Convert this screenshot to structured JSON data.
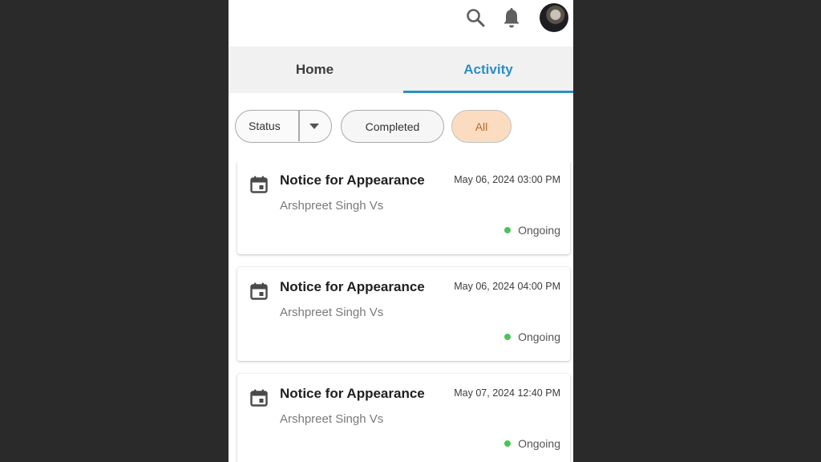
{
  "topbar": {
    "icons": [
      "search-icon",
      "bell-icon",
      "avatar"
    ]
  },
  "tabs": [
    {
      "label": "Home",
      "active": false
    },
    {
      "label": "Activity",
      "active": true
    }
  ],
  "colors": {
    "accent": "#2b8fc6",
    "chip_active_bg": "#fcdcc0",
    "chip_active_text": "#b8682a",
    "status_ongoing": "#4cc35a",
    "backdrop": "#2a2a2a"
  },
  "filters": {
    "status_label": "Status",
    "completed_label": "Completed",
    "all_label": "All",
    "selected": "All"
  },
  "activities": [
    {
      "title": "Notice for Appearance",
      "datetime": "May 06, 2024 03:00 PM",
      "subtitle": "Arshpreet Singh Vs",
      "status": "Ongoing",
      "icon": "calendar-icon"
    },
    {
      "title": "Notice for Appearance",
      "datetime": "May 06, 2024 04:00 PM",
      "subtitle": "Arshpreet Singh Vs",
      "status": "Ongoing",
      "icon": "calendar-icon"
    },
    {
      "title": "Notice for Appearance",
      "datetime": "May 07, 2024 12:40 PM",
      "subtitle": "Arshpreet Singh Vs",
      "status": "Ongoing",
      "icon": "calendar-icon"
    }
  ]
}
